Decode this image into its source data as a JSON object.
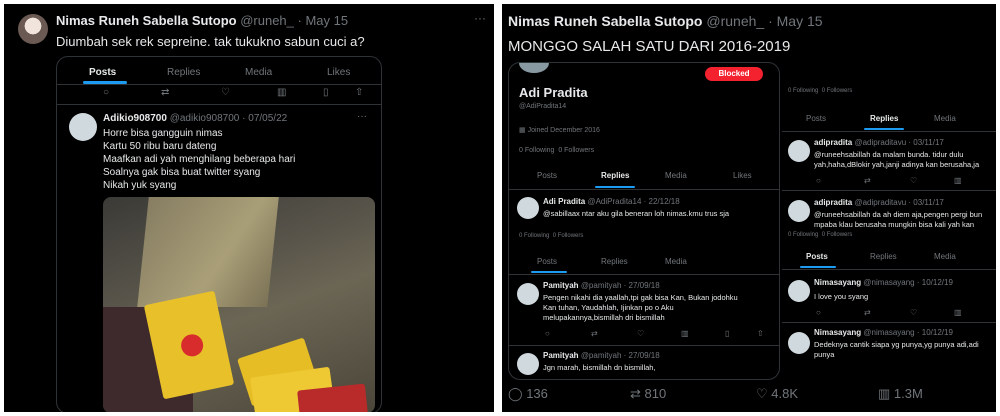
{
  "left": {
    "author": "Nimas Runeh Sabella Sutopo",
    "handle": "@runeh_",
    "date": "· May 15",
    "text": "Diumbah sek rek sepreine. tak tukukno sabun cuci a?",
    "tabs": [
      "Posts",
      "Replies",
      "Media",
      "Likes"
    ],
    "inner": {
      "name": "Adikio908700",
      "handle": "@adikio908700",
      "date": "· 07/05/22",
      "more": "···",
      "lines": [
        "Horre bisa gangguin nimas",
        "Kartu 50 ribu baru dateng",
        "Maafkan adi yah menghilang beberapa hari",
        "Soalnya gak bisa buat twitter syang",
        "Nikah yuk syang"
      ]
    }
  },
  "right": {
    "author": "Nimas Runeh Sabella Sutopo",
    "handle": "@runeh_",
    "date": "· May 15",
    "text": "MONGGO SALAH SATU DARI 2016-2019",
    "profile": {
      "blocked": "Blocked",
      "name": "Adi Pradita",
      "handle": "@AdiPradita14",
      "joined": "Joined December 2016",
      "following": "0 Following",
      "followers": "0 Followers"
    },
    "tabs1": [
      "Posts",
      "Replies",
      "Media",
      "Likes"
    ],
    "tabs2": [
      "Posts",
      "Replies",
      "Media"
    ],
    "tabs3": [
      "Posts",
      "Replies",
      "Media"
    ],
    "tabs4": [
      "Posts",
      "Replies",
      "Media"
    ],
    "reply1": {
      "name": "Adi Pradita",
      "handle": "@AdiPradita14",
      "date": "· 22/12/18",
      "text": "@sabillaax ntar aku gila beneran loh nimas.kmu trus sja"
    },
    "top_right_counts": {
      "following": "0 Following",
      "followers": "0 Followers"
    },
    "mid_counts": {
      "following": "0 Following",
      "followers": "0 Followers"
    },
    "small_counts": {
      "following": "0 Following",
      "followers": "0 Followers"
    },
    "pam1": {
      "name": "Pamityah",
      "handle": "@pamityah",
      "date": "· 27/09/18",
      "lines": [
        "Pengen nikahi dia yaallah,tpi gak bisa Kan, Bukan jodohku",
        "Kan tuhan, Yaudahlah, Ijinkan po o Aku",
        "melupakannya,bismillah dri bismillah"
      ]
    },
    "pam2": {
      "name": "Pamityah",
      "handle": "@pamityah",
      "date": "· 27/09/18",
      "lines": [
        "Jgn marah, bismillah dn bismillah,"
      ]
    },
    "adi1": {
      "name": "adipradita",
      "handle": "@adipraditavu",
      "date": "· 03/11/17",
      "lines": [
        "@runeehsabillah da malam bunda. tidur dulu",
        "yah,haha,dBlokir yah,janji adinya kan berusaha,ja"
      ]
    },
    "adi2": {
      "name": "adipradita",
      "handle": "@adipraditavu",
      "date": "· 03/11/17",
      "lines": [
        "@runeehsabillah da ah diem aja,pengen pergi bun",
        "mpaba klau berusaha mungkin bisa kali yah kan"
      ]
    },
    "nim1": {
      "name": "Nimasayang",
      "handle": "@nimasayang",
      "date": "· 10/12/19",
      "lines": [
        "I love you syang"
      ]
    },
    "nim2": {
      "name": "Nimasayang",
      "handle": "@nimasayang",
      "date": "· 10/12/19",
      "lines": [
        "Dedeknya cantik siapa yg punya,yg punya adi,adi",
        "punya"
      ]
    },
    "stats": {
      "replies": "136",
      "reposts": "810",
      "likes": "4.8K",
      "views": "1.3M"
    }
  }
}
